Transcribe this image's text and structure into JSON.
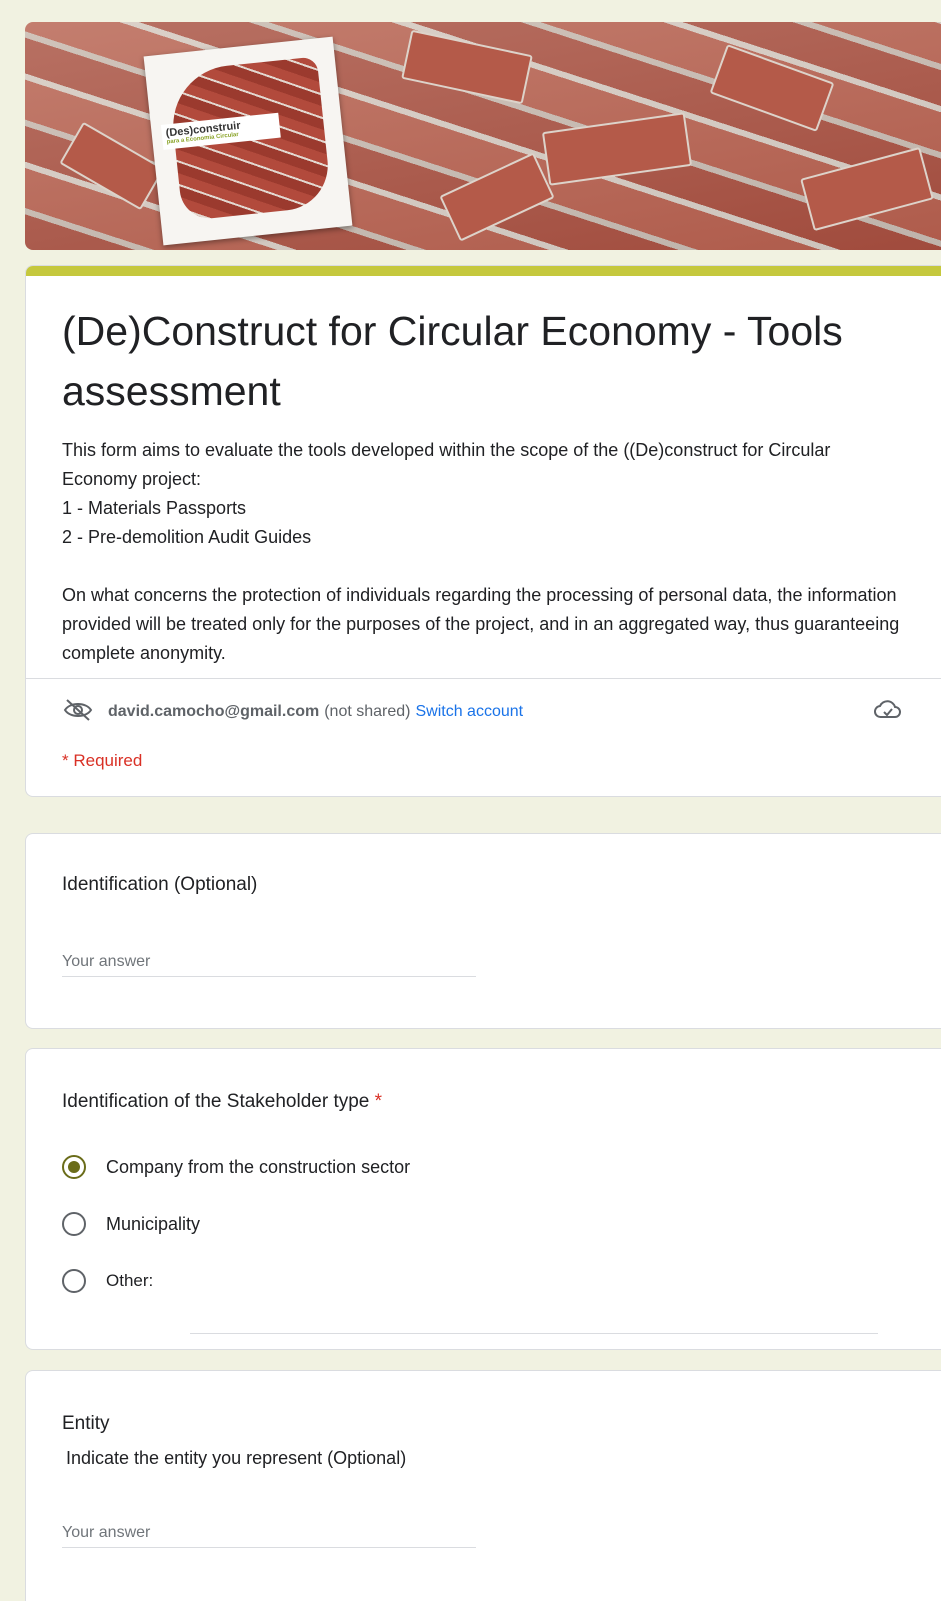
{
  "form": {
    "title": "(De)Construct for Circular Economy - Tools assessment",
    "description": "This form aims to evaluate the tools developed within the scope of the ((De)construct for Circular Economy project:\n1 - Materials Passports\n2 - Pre-demolition Audit Guides\n\nOn what concerns the protection of individuals regarding the processing of personal data, the information provided will be treated only for the purposes of the project, and in an aggregated way, thus guaranteeing complete anonymity.",
    "header_poster_text": "(Des)construir",
    "header_poster_subtext": "para a Economia Circular"
  },
  "account": {
    "email": "david.camocho@gmail.com",
    "not_shared": "(not shared)",
    "switch_label": "Switch account"
  },
  "required_note": "* Required",
  "questions": {
    "identification": {
      "title": "Identification (Optional)",
      "placeholder": "Your answer"
    },
    "stakeholder": {
      "title": "Identification of the Stakeholder type",
      "required_mark": "*",
      "options": [
        {
          "label": "Company from the construction sector",
          "selected": true
        },
        {
          "label": "Municipality",
          "selected": false
        },
        {
          "label": "Other:",
          "selected": false
        }
      ]
    },
    "entity": {
      "title": "Entity",
      "description": "Indicate the entity you represent (Optional)",
      "placeholder": "Your answer"
    }
  },
  "colors": {
    "accent": "#c5c83d",
    "radio_selected": "#6a6c19",
    "link": "#1a73e8",
    "required": "#d93025",
    "background": "#f1f2e1"
  },
  "icons": [
    "eye-off-icon",
    "cloud-saved-icon"
  ]
}
